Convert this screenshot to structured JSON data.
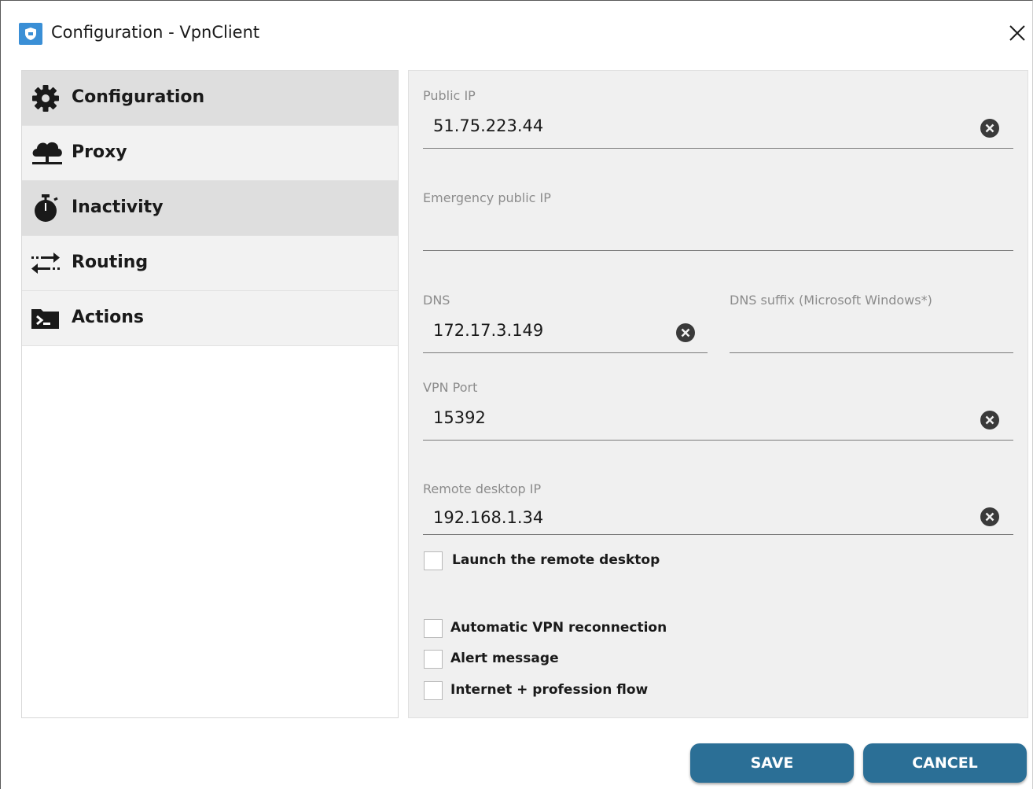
{
  "window": {
    "title": "Configuration - VpnClient",
    "icon": "shield-app-icon",
    "close_icon": "close-icon"
  },
  "sidebar": {
    "items": [
      {
        "label": "Configuration",
        "icon": "gear-icon"
      },
      {
        "label": "Proxy",
        "icon": "cloud-network-icon"
      },
      {
        "label": "Inactivity",
        "icon": "stopwatch-icon"
      },
      {
        "label": "Routing",
        "icon": "arrows-exchange-icon"
      },
      {
        "label": "Actions",
        "icon": "terminal-icon"
      }
    ]
  },
  "form": {
    "public_ip": {
      "label": "Public IP",
      "value": "51.75.223.44"
    },
    "emergency_ip": {
      "label": "Emergency public IP",
      "value": ""
    },
    "dns": {
      "label": "DNS",
      "value": "172.17.3.149"
    },
    "dns_suffix": {
      "label": "DNS suffix (Microsoft Windows*)",
      "value": ""
    },
    "vpn_port": {
      "label": "VPN Port",
      "value": "15392"
    },
    "remote_desktop_ip": {
      "label": "Remote desktop IP",
      "value": "192.168.1.34"
    },
    "checkboxes": {
      "launch_remote_desktop": {
        "label": "Launch the remote desktop",
        "checked": false
      },
      "auto_reconnect": {
        "label": "Automatic VPN reconnection",
        "checked": false
      },
      "alert_message": {
        "label": "Alert message",
        "checked": false
      },
      "internet_profession_flow": {
        "label": "Internet + profession flow",
        "checked": false
      }
    }
  },
  "buttons": {
    "save": "SAVE",
    "cancel": "CANCEL"
  },
  "colors": {
    "button_bg": "#2b6f96",
    "panel_bg": "#f0f0f0",
    "sidebar_active_bg": "#dedede",
    "app_icon_bg": "#3a8fd6"
  }
}
